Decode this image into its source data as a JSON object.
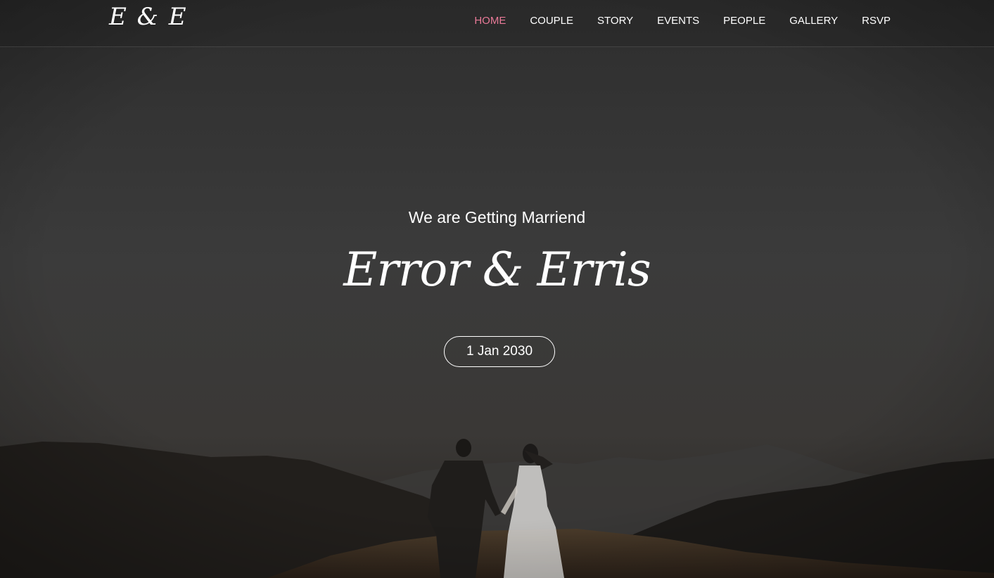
{
  "brand": {
    "logo_text": "E & E"
  },
  "nav": {
    "items": [
      {
        "label": "HOME",
        "active": true
      },
      {
        "label": "COUPLE",
        "active": false
      },
      {
        "label": "STORY",
        "active": false
      },
      {
        "label": "EVENTS",
        "active": false
      },
      {
        "label": "PEOPLE",
        "active": false
      },
      {
        "label": "GALLERY",
        "active": false
      },
      {
        "label": "RSVP",
        "active": false
      }
    ],
    "active_color": "#e97a98"
  },
  "hero": {
    "subtitle": "We are Getting Marriend",
    "names": "Error & Erris",
    "date": "1 Jan 2030",
    "background_description_colors": {
      "overlay": "#333333",
      "sky": "#3a3a3a",
      "hills": "#1e1b18",
      "field": "#5a4630"
    }
  }
}
